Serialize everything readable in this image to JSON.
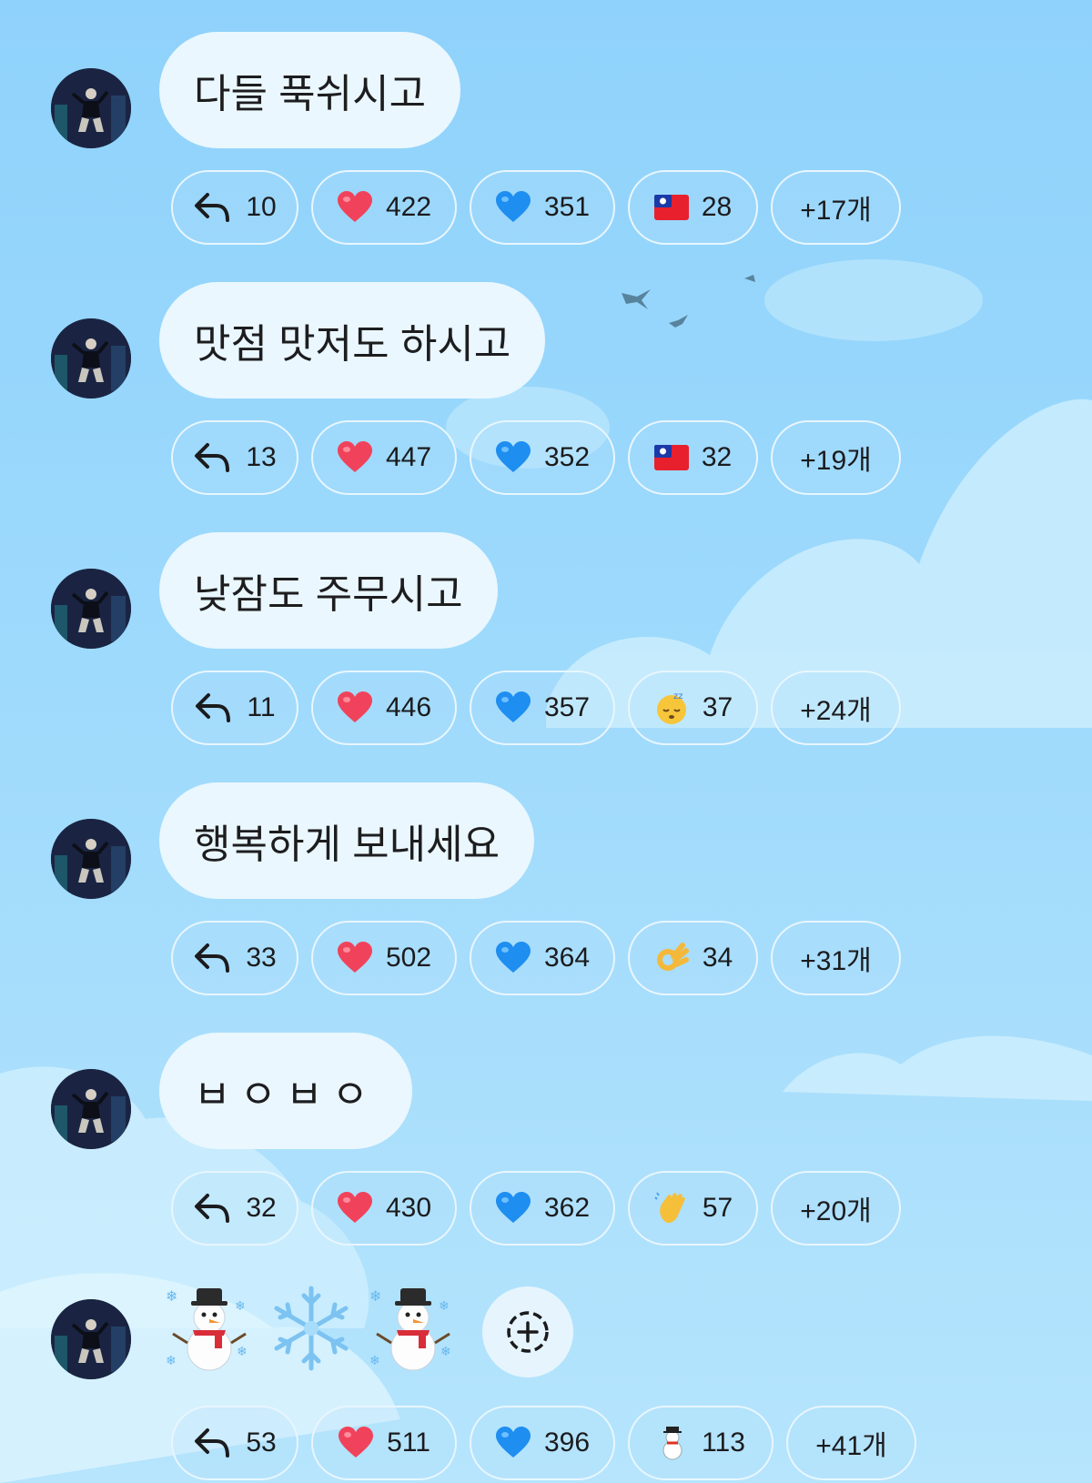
{
  "messages": [
    {
      "text": "다들 푹쉬시고",
      "reactions": {
        "replies": "10",
        "heart_red": "422",
        "heart_blue": "351",
        "third": "28",
        "more": "+17개"
      },
      "third_icon": "taiwan-flag"
    },
    {
      "text": "맛점 맛저도 하시고",
      "reactions": {
        "replies": "13",
        "heart_red": "447",
        "heart_blue": "352",
        "third": "32",
        "more": "+19개"
      },
      "third_icon": "taiwan-flag"
    },
    {
      "text": "낮잠도 주무시고",
      "reactions": {
        "replies": "11",
        "heart_red": "446",
        "heart_blue": "357",
        "third": "37",
        "more": "+24개"
      },
      "third_icon": "sleeping-face"
    },
    {
      "text": "행복하게 보내세요",
      "reactions": {
        "replies": "33",
        "heart_red": "502",
        "heart_blue": "364",
        "third": "34",
        "more": "+31개"
      },
      "third_icon": "ok-hand"
    },
    {
      "text": "ㅂㅇㅂㅇ",
      "reactions": {
        "replies": "32",
        "heart_red": "430",
        "heart_blue": "362",
        "third": "57",
        "more": "+20개"
      },
      "third_icon": "waving-hand"
    },
    {
      "text": "",
      "emojis": [
        "snowman",
        "snowflake",
        "snowman"
      ],
      "reactions": {
        "replies": "53",
        "heart_red": "511",
        "heart_blue": "396",
        "third": "113",
        "more": "+41개"
      },
      "third_icon": "snowman"
    }
  ],
  "colors": {
    "background": "#9cd9fc",
    "bubble": "#eaf7fe",
    "heart_red": "#f0435b",
    "heart_blue": "#1e8ef0"
  }
}
